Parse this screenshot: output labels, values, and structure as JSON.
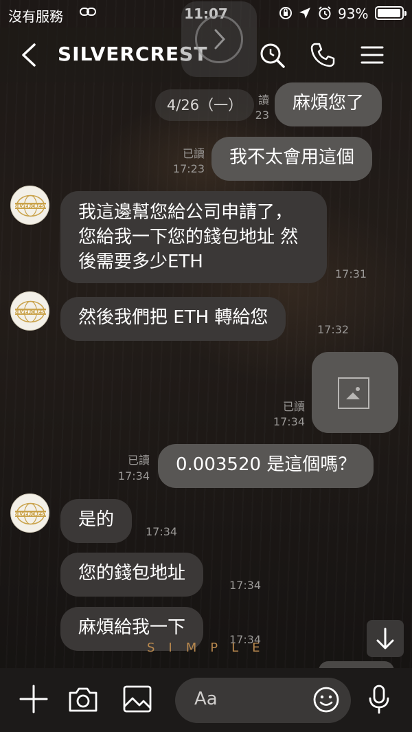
{
  "status_bar": {
    "carrier": "沒有服務",
    "time": "11:07",
    "battery_pct": "93%",
    "icons": [
      "link-icon",
      "screen-rotation-lock-icon",
      "location-arrow-icon",
      "alarm-icon"
    ]
  },
  "header": {
    "title": "SILVERCREST",
    "icons": [
      "back-chevron-icon",
      "search-icon",
      "phone-icon",
      "menu-icon"
    ]
  },
  "chat": {
    "date_chip": "4/26（一）",
    "messages": [
      {
        "side": "right",
        "text": "麻煩您了"
      },
      {
        "side": "right",
        "text": "我不太會用這個",
        "read": "已讀",
        "time": "17:23"
      },
      {
        "side": "left",
        "text": "我這邊幫您給公司申請了，您給我一下您的錢包地址 然後需要多少ETH",
        "time": "17:31"
      },
      {
        "side": "left",
        "text": "然後我們把 ETH 轉給您",
        "time": "17:32"
      },
      {
        "side": "right",
        "type": "image",
        "read": "已讀",
        "time": "17:34"
      },
      {
        "side": "right",
        "text": "0.003520 是這個嗎？",
        "read": "已讀",
        "time": "17:34"
      },
      {
        "side": "left",
        "text": "是的",
        "time": "17:34"
      },
      {
        "side": "left",
        "text": "您的錢包地址",
        "time": "17:34"
      },
      {
        "side": "left",
        "text": "麻煩給我一下",
        "time": "17:34"
      }
    ],
    "partial_read": "讀",
    "partial_time": "23",
    "watermark": "SIMPLE",
    "avatar_name": "SILVERCREST"
  },
  "input_bar": {
    "placeholder": "Aa",
    "icons": [
      "plus-icon",
      "camera-icon",
      "image-icon",
      "emoji-icon",
      "microphone-icon"
    ]
  }
}
